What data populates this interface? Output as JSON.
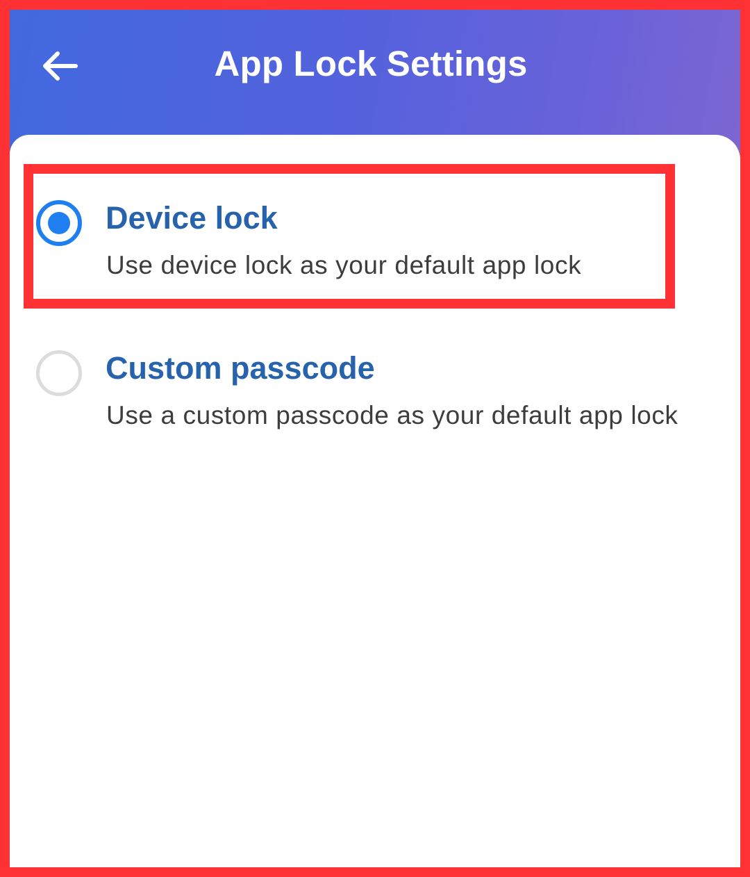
{
  "header": {
    "title": "App Lock Settings",
    "back_icon": "arrow-left-icon",
    "gradient_colors": [
      "#4269de",
      "#5362dd",
      "#7c67d2"
    ]
  },
  "options": [
    {
      "title": "Device lock",
      "description": "Use device lock as your default app lock",
      "selected": true
    },
    {
      "title": "Custom passcode",
      "description": "Use a custom passcode as your default app lock",
      "selected": false
    }
  ],
  "colors": {
    "accent": "#1f7ff0",
    "option_title": "#2763ac",
    "description": "#3d3d3d",
    "highlight_border": "#fe3135"
  }
}
